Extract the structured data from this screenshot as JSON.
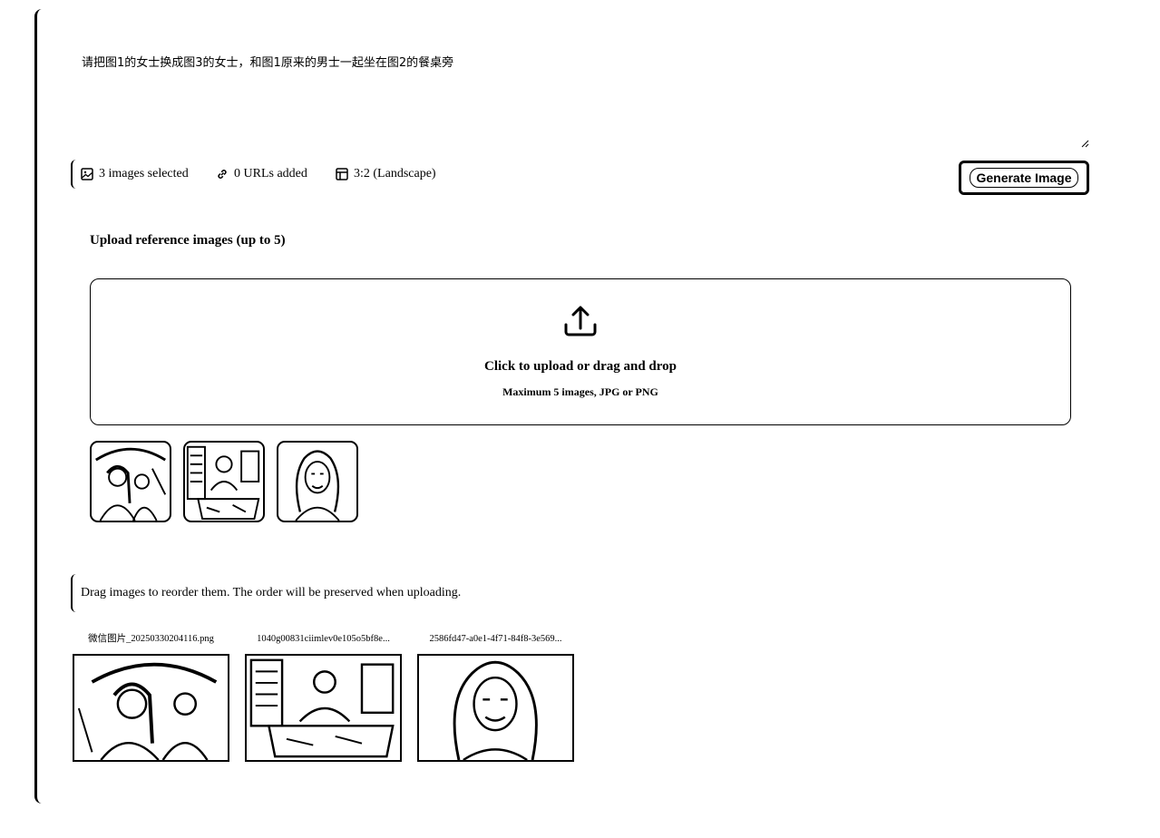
{
  "prompt": {
    "value": "请把图1的女士换成图3的女士，和图1原来的男士一起坐在图2的餐桌旁"
  },
  "toolbar": {
    "images_selected": "3 images selected",
    "urls_added": "0 URLs added",
    "aspect_ratio": "3:2 (Landscape)",
    "generate_label": "Generate Image"
  },
  "upload": {
    "title": "Upload reference images (up to 5)",
    "drop_main": "Click to upload or drag and drop",
    "drop_sub": "Maximum 5 images, JPG or PNG"
  },
  "reorder": {
    "note": "Drag images to reorder them. The order will be preserved when uploading.",
    "files": [
      {
        "name": "微信图片_20250330204116.png"
      },
      {
        "name": "1040g00831ciimlev0e105o5bf8e..."
      },
      {
        "name": "2586fd47-a0e1-4f71-84f8-3e569..."
      }
    ]
  },
  "icons": [
    "image-icon",
    "link-icon",
    "layout-icon",
    "upload-icon",
    "resize-handle-icon"
  ]
}
